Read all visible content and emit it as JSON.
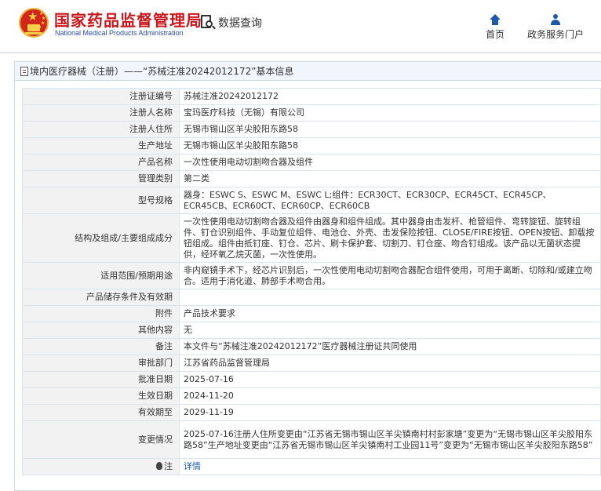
{
  "header": {
    "site_title": "国家药品监督管理局",
    "site_subtitle": "National Medical Products Administration",
    "query_label": "数据查询",
    "nav": {
      "home_label": "首页",
      "service_label": "政务服务门户"
    }
  },
  "breadcrumb": {
    "text": "境内医疗器械（注册）——“苏械注准20242012172”基本信息"
  },
  "rows": [
    {
      "label": "注册证编号",
      "value": "苏械注准20242012172"
    },
    {
      "label": "注册人名称",
      "value": "宝玛医疗科技（无锡）有限公司"
    },
    {
      "label": "注册人住所",
      "value": "无锡市锡山区羊尖胶阳东路58"
    },
    {
      "label": "生产地址",
      "value": "无锡市锡山区羊尖胶阳东路58"
    },
    {
      "label": "产品名称",
      "value": "一次性使用电动切割吻合器及组件"
    },
    {
      "label": "管理类别",
      "value": "第二类"
    },
    {
      "label": "型号规格",
      "value": "器身：ESWC S、ESWC M、ESWC L;组件：ECR30CT、ECR30CP、ECR45CT、ECR45CP、ECR45CB、ECR60CT、ECR60CP、ECR60CB"
    },
    {
      "label": "结构及组成/主要组成成分",
      "value": "一次性使用电动切割吻合器及组件由器身和组件组成。其中器身由击发杆、枪管组件、弯转旋钮、旋转组件、钉仓识别组件、手动复位组件、电池仓、外壳、击发保险按钮、CLOSE/FIRE按钮、OPEN按钮、卸载按钮组成。组件由抵钉座、钉仓、芯片、刷卡保护套、切割刀、钉仓座、吻合钉组成。该产品以无菌状态提供，经环氧乙烷灭菌，一次性使用。"
    },
    {
      "label": "适用范围/预期用途",
      "value": "非内窥镜手术下，经芯片识别后，一次性使用电动切割吻合器配合组件使用，可用于离断、切除和/或建立吻合。适用于消化道、肺部手术吻合用。"
    },
    {
      "label": "产品储存条件及有效期",
      "value": ""
    },
    {
      "label": "附件",
      "value": "产品技术要求"
    },
    {
      "label": "其他内容",
      "value": "无"
    },
    {
      "label": "备注",
      "value": "本文件与“苏械注准20242012172”医疗器械注册证共同使用"
    },
    {
      "label": "审批部门",
      "value": "江苏省药品监督管理局"
    },
    {
      "label": "批准日期",
      "value": "2025-07-16"
    },
    {
      "label": "生效日期",
      "value": "2024-11-20"
    },
    {
      "label": "有效期至",
      "value": "2029-11-19"
    },
    {
      "label": "变更情况",
      "value": "2025-07-16注册人住所变更由“江苏省无锡市锡山区羊尖镇南村村彭家塘”变更为“无锡市锡山区羊尖胶阳东路58”生产地址变更由“江苏省无锡市锡山区羊尖镇南村工业园11号”变更为“无锡市锡山区羊尖胶阳东路58”"
    }
  ],
  "note": {
    "label": "注",
    "link": "详情"
  },
  "colors": {
    "brand_red": "#c8161d",
    "link_blue": "#1f5aa8",
    "label_bg": "#f2f2f2",
    "panel_head_bg": "#f0f6fb"
  }
}
